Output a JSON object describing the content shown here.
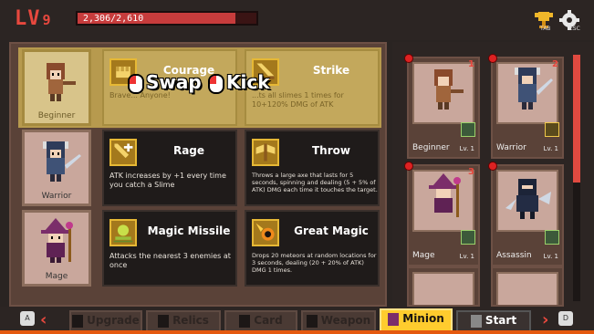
{
  "hud": {
    "level_prefix": "LV",
    "level": "9",
    "xp_text": "2,306/2,610",
    "xp_fraction": 0.8835,
    "tab_tag": "TAB",
    "esc_tag": "ESC"
  },
  "colors": {
    "accent_red": "#e8483e",
    "selected_gold": "#b79a4e",
    "active_tab": "#ffcc2e"
  },
  "overlay": {
    "swap_label": "Swap",
    "kick_label": "Kick"
  },
  "classes": [
    {
      "portrait_label": "Beginner",
      "skills": [
        {
          "title": "Courage",
          "desc": "Brave... Anyone!",
          "icon": "fist-icon"
        },
        {
          "title": "Strike",
          "desc": "...ts all slimes 1 times for 10+120% DMG of ATK",
          "icon": "sword-strike-icon"
        }
      ]
    },
    {
      "portrait_label": "Warrior",
      "skills": [
        {
          "title": "Rage",
          "desc": "ATK increases by +1 every time you catch a Slime",
          "icon": "sword-plus-icon"
        },
        {
          "title": "Throw",
          "desc": "Throws a large axe that lasts for 5 seconds, spinning and dealing (5 + 5% of ATK) DMG each time it touches the target.",
          "icon": "axe-icon"
        }
      ]
    },
    {
      "portrait_label": "Mage",
      "skills": [
        {
          "title": "Magic Missile",
          "desc": "Attacks the nearest 3 enemies at once",
          "icon": "missile-icon"
        },
        {
          "title": "Great Magic",
          "desc": "Drops 20 meteors at random locations for 3 seconds, dealing (20 + 20% of ATK) DMG 1 times.",
          "icon": "meteor-icon"
        }
      ]
    }
  ],
  "minions": [
    {
      "name": "Beginner",
      "level": "Lv. 1",
      "count": "1"
    },
    {
      "name": "Warrior",
      "level": "Lv. 1",
      "count": "2"
    },
    {
      "name": "Mage",
      "level": "Lv. 1",
      "count": "3"
    },
    {
      "name": "Assassin",
      "level": "Lv. 1",
      "count": ""
    }
  ],
  "tabs": [
    {
      "label": "Upgrade"
    },
    {
      "label": "Relics"
    },
    {
      "label": "Card"
    },
    {
      "label": "Weapon"
    },
    {
      "label": "Minion"
    },
    {
      "label": "Start"
    }
  ],
  "keys": {
    "left_key": "A",
    "right_key": "D"
  }
}
